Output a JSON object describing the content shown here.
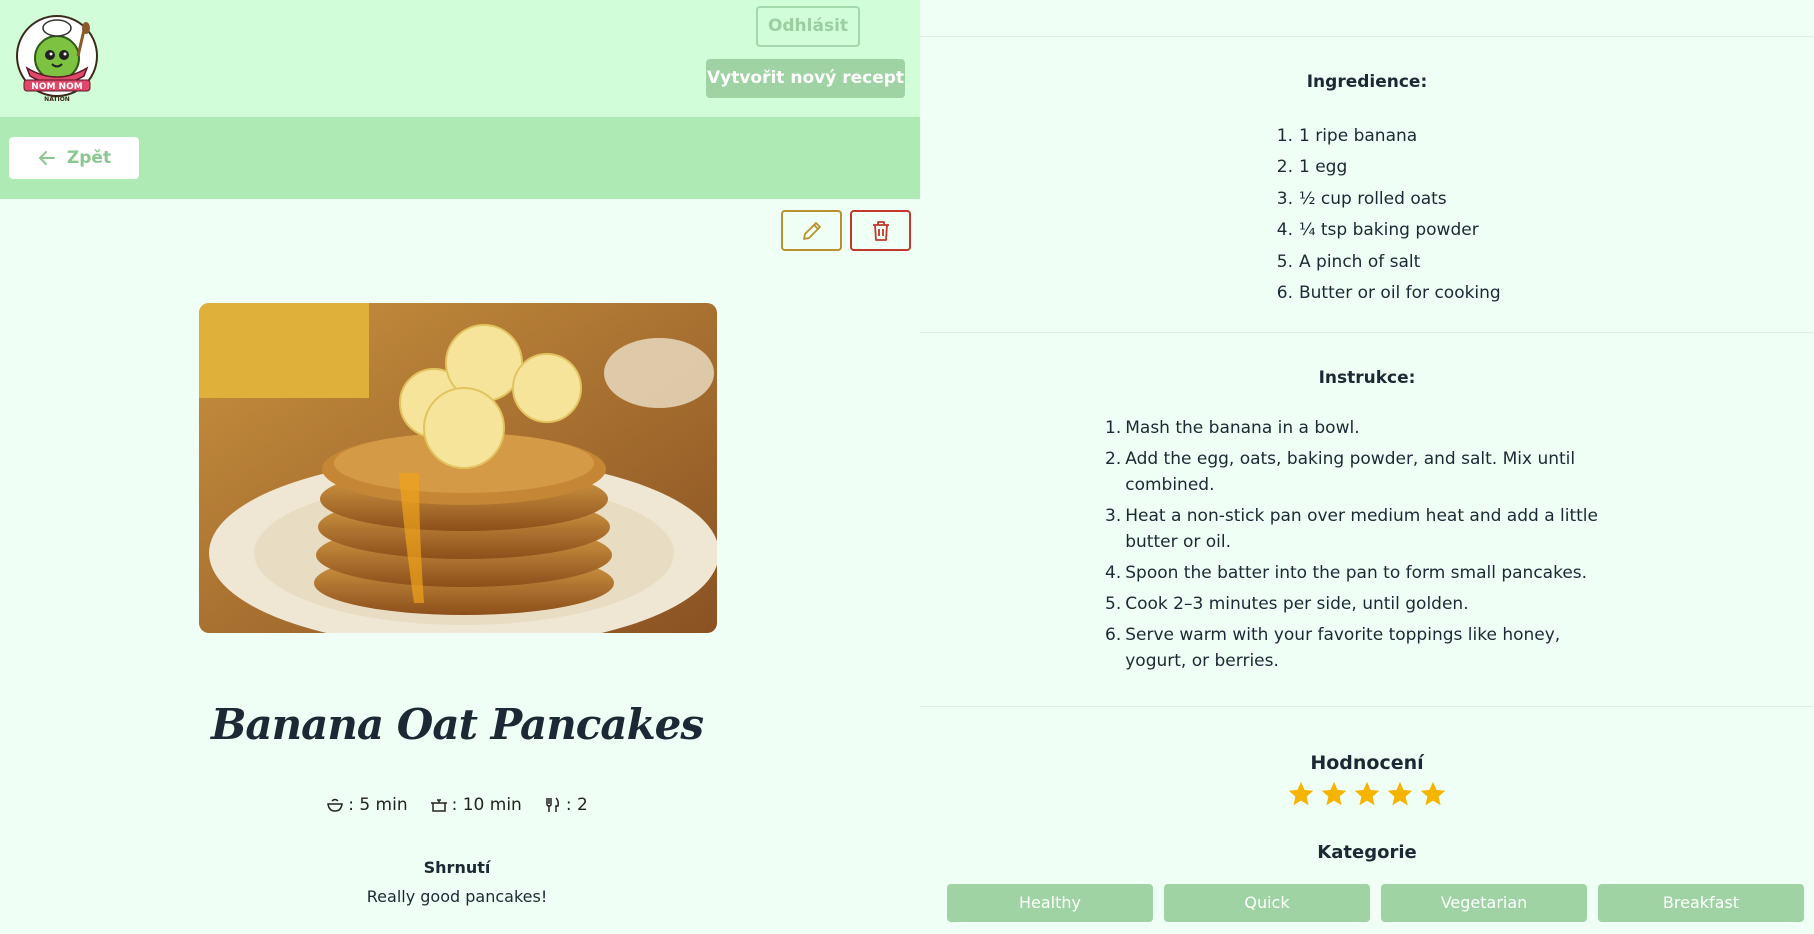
{
  "header": {
    "logo_text": "NOM NOM NATION",
    "logout_label": "Odhlásit",
    "new_recipe_label": "Vytvořit nový recept"
  },
  "nav": {
    "back_label": "Zpět"
  },
  "recipe": {
    "title": "Banana Oat Pancakes",
    "prep_time": ": 5 min",
    "cook_time": ": 10 min",
    "servings": ": 2",
    "summary_heading": "Shrnutí",
    "summary_text": "Really good pancakes!",
    "photo_alt": "food-photo"
  },
  "ingredients": {
    "heading": "Ingredience:",
    "items": [
      {
        "num": "1.",
        "text": "1 ripe banana"
      },
      {
        "num": "2.",
        "text": "1 egg"
      },
      {
        "num": "3.",
        "text": "½ cup rolled oats"
      },
      {
        "num": "4.",
        "text": "¼ tsp baking powder"
      },
      {
        "num": "5.",
        "text": "A pinch of salt"
      },
      {
        "num": "6.",
        "text": "Butter or oil for cooking"
      }
    ]
  },
  "instructions": {
    "heading": "Instrukce:",
    "items": [
      {
        "num": "1.",
        "text": "Mash the banana in a bowl."
      },
      {
        "num": "2.",
        "text": "Add the egg, oats, baking powder, and salt. Mix until combined."
      },
      {
        "num": "3.",
        "text": "Heat a non-stick pan over medium heat and add a little butter or oil."
      },
      {
        "num": "4.",
        "text": "Spoon the batter into the pan to form small pancakes."
      },
      {
        "num": "5.",
        "text": "Cook 2–3 minutes per side, until golden."
      },
      {
        "num": "6.",
        "text": "Serve warm with your favorite toppings like honey, yogurt, or berries."
      }
    ]
  },
  "rating": {
    "heading": "Hodnocení",
    "value": 5,
    "max": 5
  },
  "categories": {
    "heading": "Kategorie",
    "items": [
      "Healthy",
      "Quick",
      "Vegetarian",
      "Breakfast"
    ]
  },
  "colors": {
    "topbar": "#d1fdd8",
    "subbar": "#aeeab4",
    "background": "#f0fff5",
    "button_green": "#9fd3a3",
    "edit_gold": "#b8902e",
    "delete_red": "#c0392b",
    "star": "#f5b400"
  },
  "icons": {
    "edit": "pencil-icon",
    "delete": "trash-icon",
    "back": "arrow-left-icon",
    "prep": "bowl-icon",
    "cook": "pot-icon",
    "servings": "fork-knife-icon",
    "rating": "star-icon"
  }
}
